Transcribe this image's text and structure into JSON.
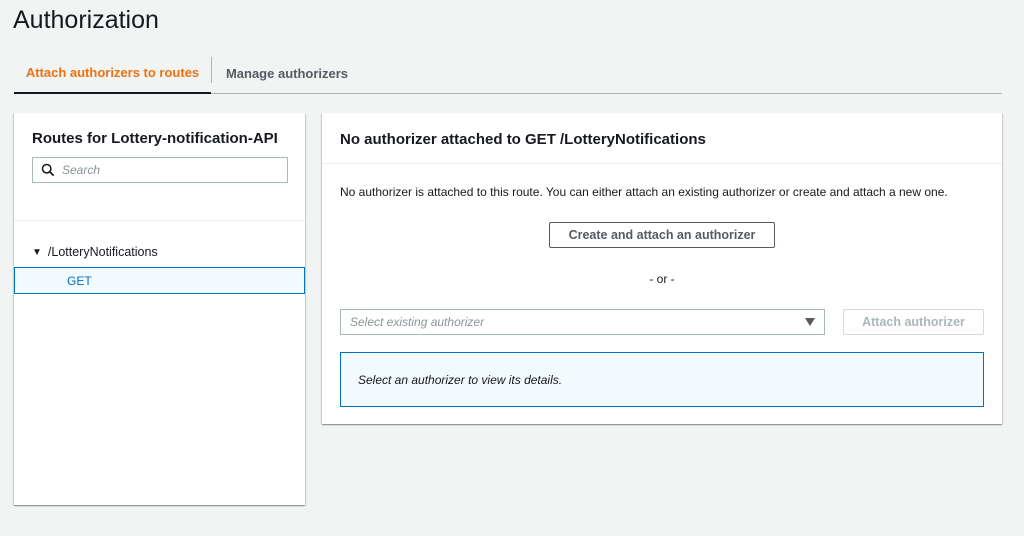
{
  "page": {
    "title": "Authorization"
  },
  "tabs": [
    {
      "label": "Attach authorizers to routes",
      "active": true
    },
    {
      "label": "Manage authorizers",
      "active": false
    }
  ],
  "routes_panel": {
    "title": "Routes for Lottery-notification-API",
    "search_placeholder": "Search",
    "resource": "/LotteryNotifications",
    "method": "GET"
  },
  "detail_panel": {
    "title": "No authorizer attached to GET /LotteryNotifications",
    "description": "No authorizer is attached to this route. You can either attach an existing authorizer or create and attach a new one.",
    "create_button": "Create and attach an authorizer",
    "or_text": "- or -",
    "select_placeholder": "Select existing authorizer",
    "attach_button": "Attach authorizer",
    "info_text": "Select an authorizer to view its details."
  },
  "colors": {
    "accent": "#ec7211",
    "link": "#0073bb",
    "background": "#f2f3f3"
  }
}
